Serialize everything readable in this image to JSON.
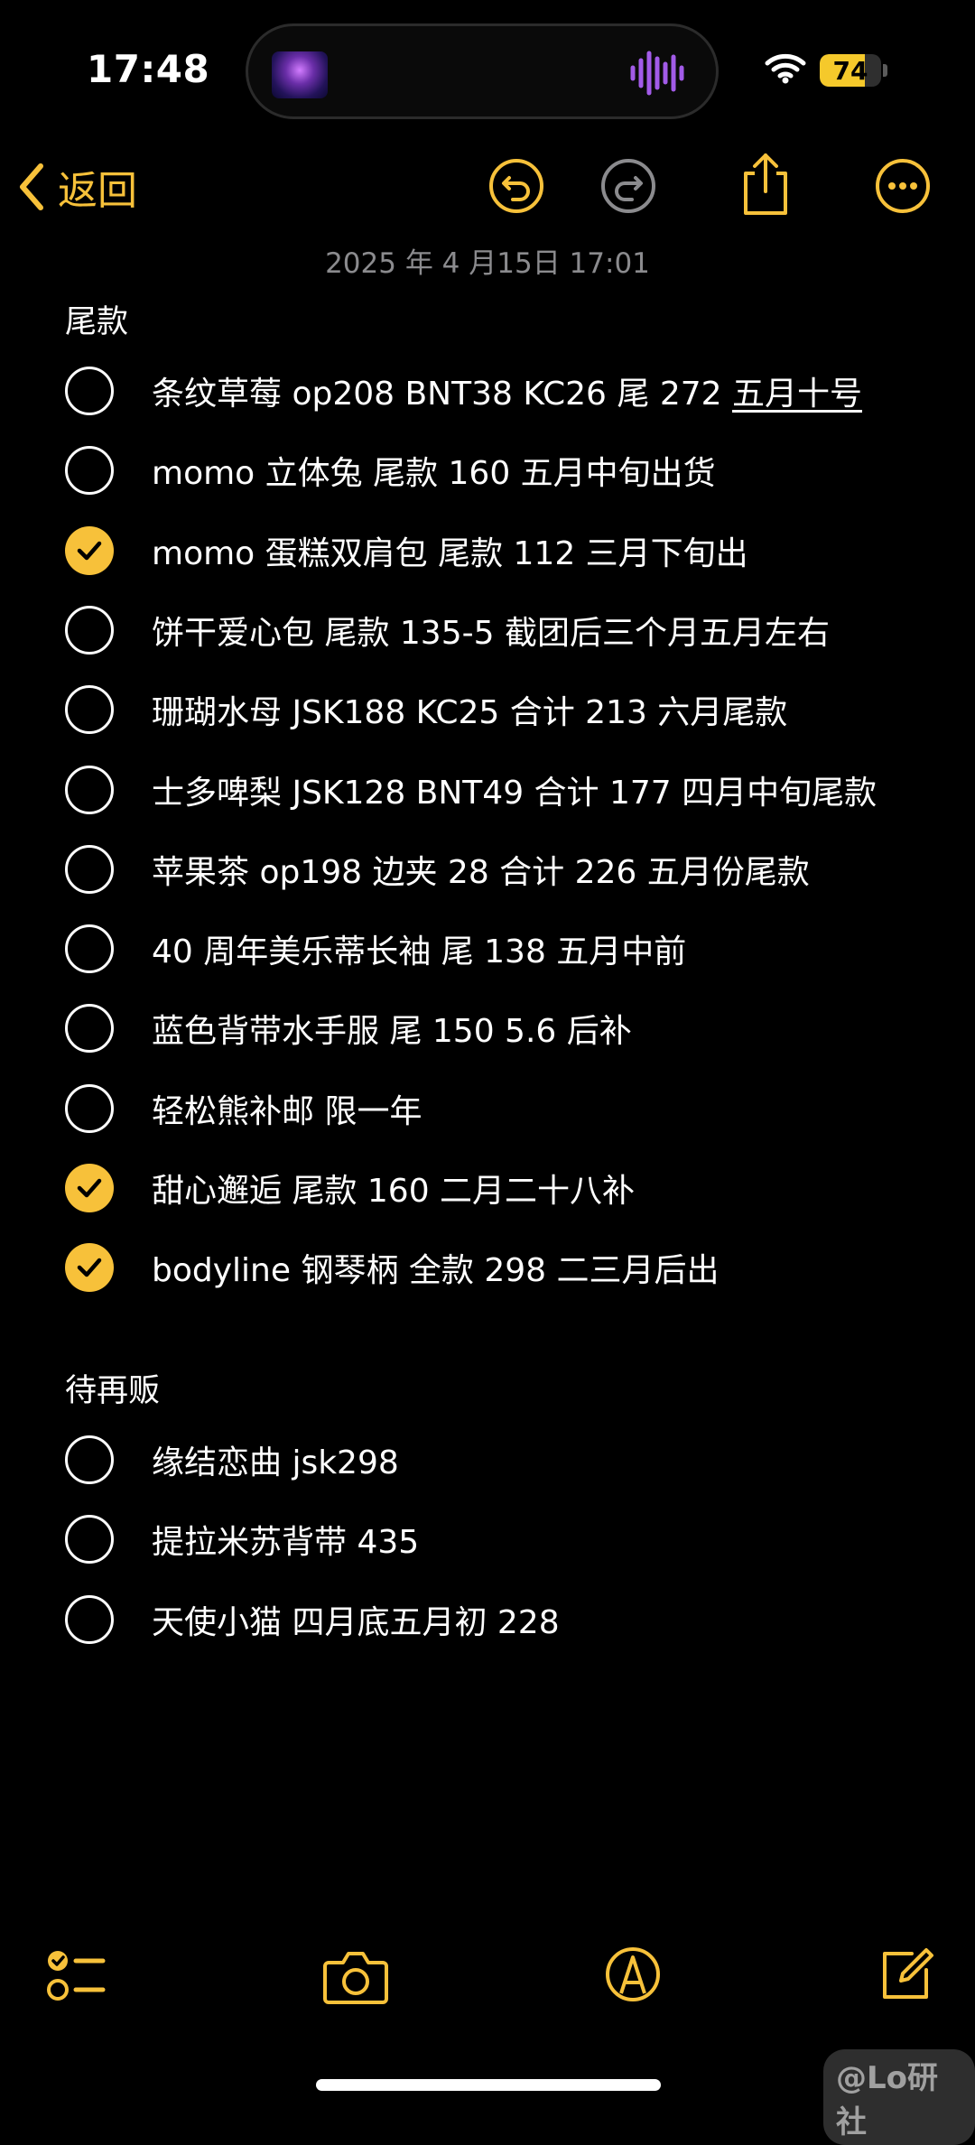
{
  "status_bar": {
    "time": "17:48",
    "battery": 74,
    "battery_text": "74",
    "icons": [
      "now-playing-thumbnail",
      "audio-waveform-icon",
      "wifi-icon",
      "battery-icon"
    ]
  },
  "nav": {
    "back_label": "返回",
    "icons": [
      "chevron-left-icon",
      "undo-icon",
      "redo-icon",
      "share-icon",
      "more-icon"
    ]
  },
  "note": {
    "date": "2025 年 4 月15日 17:01",
    "sections": [
      {
        "title": "尾款",
        "items": [
          {
            "text": "条纹草莓 op208 BNT38 KC26 尾 272 ",
            "underlined": "五月十号",
            "checked": false
          },
          {
            "text": "momo 立体兔  尾款 160 五月中旬出货",
            "checked": false
          },
          {
            "text": "momo 蛋糕双肩包  尾款 112 三月下旬出",
            "checked": true
          },
          {
            "text": "饼干爱心包  尾款 135-5  截团后三个月五月左右",
            "checked": false
          },
          {
            "text": "珊瑚水母 JSK188 KC25 合计 213 六月尾款",
            "checked": false
          },
          {
            "text": "士多啤梨 JSK128 BNT49 合计 177 四月中旬尾款",
            "checked": false
          },
          {
            "text": "苹果茶 op198 边夹 28 合计 226 五月份尾款",
            "checked": false
          },
          {
            "text": "40 周年美乐蒂长袖  尾 138 五月中前",
            "checked": false
          },
          {
            "text": "蓝色背带水手服  尾 150 5.6 后补",
            "checked": false
          },
          {
            "text": "轻松熊补邮  限一年",
            "checked": false
          },
          {
            "text": "甜心邂逅  尾款 160 二月二十八补",
            "checked": true
          },
          {
            "text": "bodyline 钢琴柄  全款 298 二三月后出",
            "checked": true
          }
        ]
      },
      {
        "title": "待再贩",
        "items": [
          {
            "text": "缘结恋曲 jsk298",
            "checked": false
          },
          {
            "text": "提拉米苏背带 435",
            "checked": false
          },
          {
            "text": "天使小猫  四月底五月初 228",
            "checked": false
          }
        ]
      }
    ]
  },
  "toolbar": {
    "icons": [
      "checklist-icon",
      "camera-icon",
      "markup-pen-icon",
      "compose-icon"
    ]
  },
  "watermark": "@Lo研社",
  "colors": {
    "accent": "#f7c13a",
    "background": "#000000",
    "text": "#ffffff",
    "secondary_text": "#8b8b8e"
  }
}
